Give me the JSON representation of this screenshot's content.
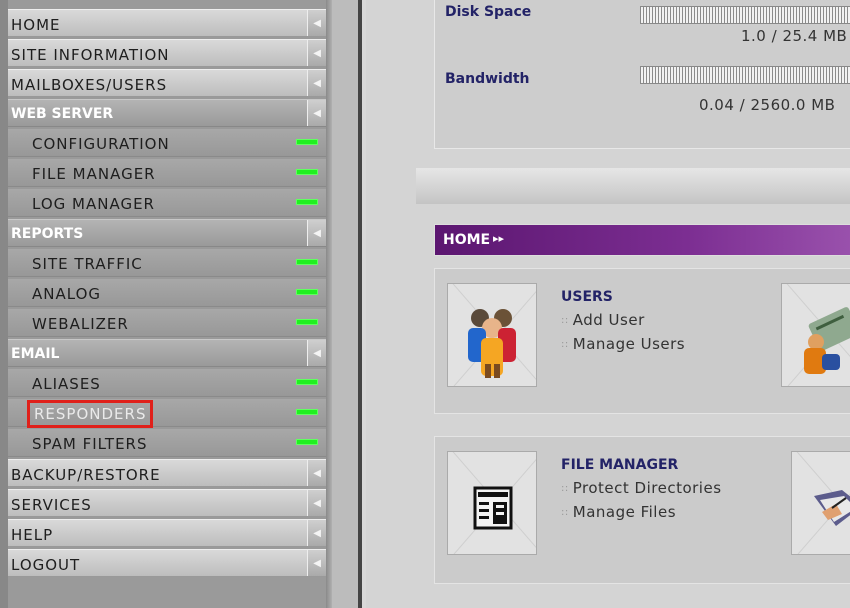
{
  "sidebar": {
    "items": [
      {
        "label": "HOME",
        "kind": "main"
      },
      {
        "label": "SITE INFORMATION",
        "kind": "main"
      },
      {
        "label": "MAILBOXES/USERS",
        "kind": "main"
      },
      {
        "label": "WEB SERVER",
        "kind": "section"
      },
      {
        "label": "CONFIGURATION",
        "kind": "sub"
      },
      {
        "label": "FILE MANAGER",
        "kind": "sub"
      },
      {
        "label": "LOG MANAGER",
        "kind": "sub"
      },
      {
        "label": "REPORTS",
        "kind": "section"
      },
      {
        "label": "SITE TRAFFIC",
        "kind": "sub"
      },
      {
        "label": "ANALOG",
        "kind": "sub"
      },
      {
        "label": "WEBALIZER",
        "kind": "sub"
      },
      {
        "label": "EMAIL",
        "kind": "section"
      },
      {
        "label": "ALIASES",
        "kind": "sub"
      },
      {
        "label": "RESPONDERS",
        "kind": "sub",
        "highlighted": true
      },
      {
        "label": "SPAM FILTERS",
        "kind": "sub"
      },
      {
        "label": "BACKUP/RESTORE",
        "kind": "main"
      },
      {
        "label": "SERVICES",
        "kind": "main"
      },
      {
        "label": "HELP",
        "kind": "main"
      },
      {
        "label": "LOGOUT",
        "kind": "main"
      }
    ],
    "status_color": "#20f020",
    "highlight_color": "#e0201a"
  },
  "usage": {
    "disk_label": "Disk Space",
    "disk_value": "1.0 / 25.4 MB",
    "bandwidth_label": "Bandwidth",
    "bandwidth_value": "0.04 / 2560.0 MB"
  },
  "home_bar": {
    "title": "HOME",
    "arrows": "▸▸",
    "color": "#6a1f80"
  },
  "panels": {
    "users": {
      "title": "USERS",
      "icon": "users-group-icon",
      "side_icon": "user-card-icon",
      "links": [
        "Add User",
        "Manage Users"
      ]
    },
    "file_manager": {
      "title": "FILE MANAGER",
      "icon": "file-list-icon",
      "side_icon": "folder-edit-icon",
      "links": [
        "Protect Directories",
        "Manage Files"
      ]
    }
  }
}
